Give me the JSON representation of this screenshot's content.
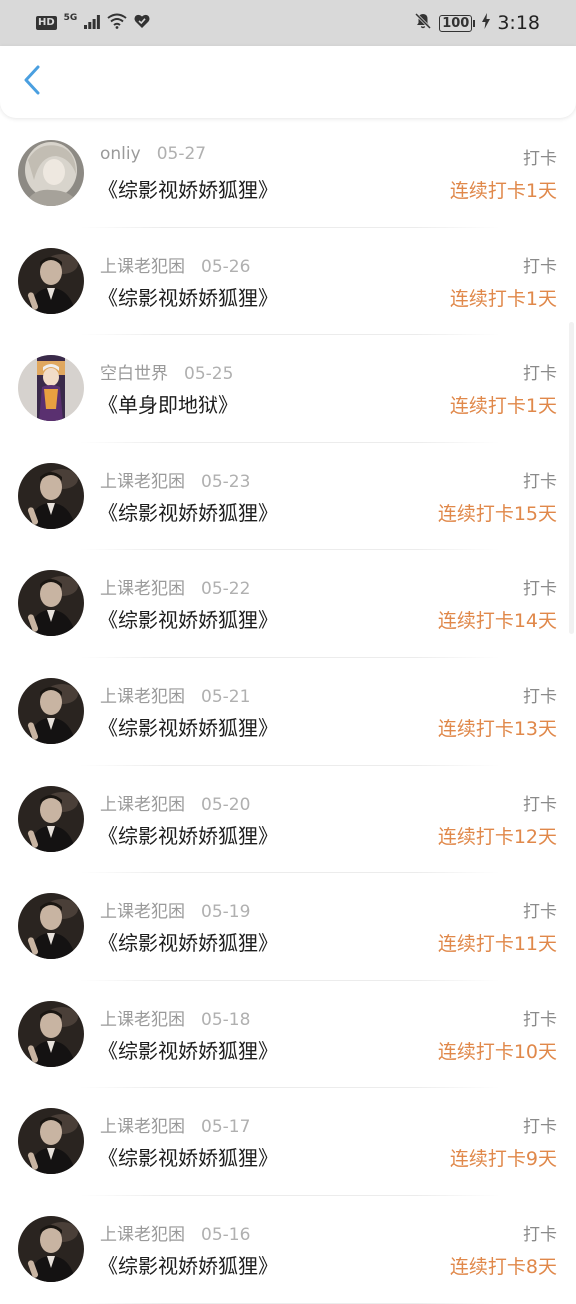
{
  "status_bar": {
    "hd_label": "HD",
    "network_label": "5G",
    "battery_level": "100",
    "time": "3:18"
  },
  "header": {
    "back_icon": "chevron-left-icon"
  },
  "colors": {
    "accent_back": "#4a9fe0",
    "streak": "#e0884a"
  },
  "items": [
    {
      "user": "onliy",
      "date": "05-27",
      "title": "《综影视娇娇狐狸》",
      "action": "打卡",
      "streak": "连续打卡1天",
      "avatar": "white-hair"
    },
    {
      "user": "上课老犯困",
      "date": "05-26",
      "title": "《综影视娇娇狐狸》",
      "action": "打卡",
      "streak": "连续打卡1天",
      "avatar": "man"
    },
    {
      "user": "空白世界",
      "date": "05-25",
      "title": "《单身即地狱》",
      "action": "打卡",
      "streak": "连续打卡1天",
      "avatar": "anime"
    },
    {
      "user": "上课老犯困",
      "date": "05-23",
      "title": "《综影视娇娇狐狸》",
      "action": "打卡",
      "streak": "连续打卡15天",
      "avatar": "man"
    },
    {
      "user": "上课老犯困",
      "date": "05-22",
      "title": "《综影视娇娇狐狸》",
      "action": "打卡",
      "streak": "连续打卡14天",
      "avatar": "man"
    },
    {
      "user": "上课老犯困",
      "date": "05-21",
      "title": "《综影视娇娇狐狸》",
      "action": "打卡",
      "streak": "连续打卡13天",
      "avatar": "man"
    },
    {
      "user": "上课老犯困",
      "date": "05-20",
      "title": "《综影视娇娇狐狸》",
      "action": "打卡",
      "streak": "连续打卡12天",
      "avatar": "man"
    },
    {
      "user": "上课老犯困",
      "date": "05-19",
      "title": "《综影视娇娇狐狸》",
      "action": "打卡",
      "streak": "连续打卡11天",
      "avatar": "man"
    },
    {
      "user": "上课老犯困",
      "date": "05-18",
      "title": "《综影视娇娇狐狸》",
      "action": "打卡",
      "streak": "连续打卡10天",
      "avatar": "man"
    },
    {
      "user": "上课老犯困",
      "date": "05-17",
      "title": "《综影视娇娇狐狸》",
      "action": "打卡",
      "streak": "连续打卡9天",
      "avatar": "man"
    },
    {
      "user": "上课老犯困",
      "date": "05-16",
      "title": "《综影视娇娇狐狸》",
      "action": "打卡",
      "streak": "连续打卡8天",
      "avatar": "man"
    }
  ]
}
